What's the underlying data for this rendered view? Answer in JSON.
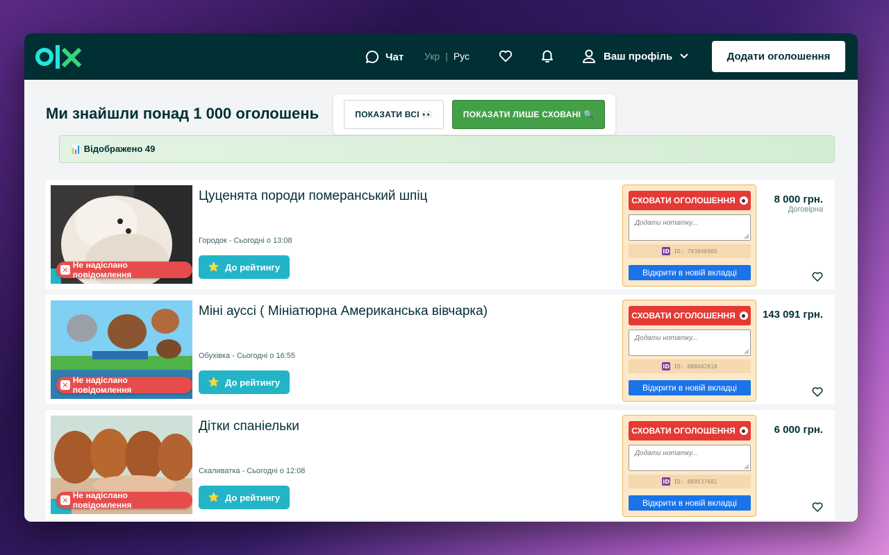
{
  "header": {
    "logo": "olx",
    "chat_label": "Чат",
    "lang_uk": "Укр",
    "lang_sep": "|",
    "lang_ru": "Рус",
    "profile_label": "Ваш профіль",
    "add_button_label": "Додати оголошення"
  },
  "main": {
    "found_title": "Ми знайшли понад 1 000 оголошень",
    "show_all_label": "ПОКАЗАТИ ВСІ 👀",
    "show_hidden_label": "ПОКАЗАТИ ЛИШЕ СХОВАНІ 🔍",
    "shown_label": "📊 Відображено 49"
  },
  "labels": {
    "no_message": "Не надіслано повідомлення",
    "rating": "До рейтингу",
    "hide": "СХОВАТИ ОГОЛОШЕННЯ",
    "note_placeholder": "Додати нотатку...",
    "open_new_tab": "Відкрити в новій вкладці"
  },
  "listings": [
    {
      "title": "Цуценята породи померанський шпіц",
      "location": "Городок - Сьогодні о 13:08",
      "price": "8 000 грн.",
      "negotiable": "Договірна",
      "id": "ID: 793846905"
    },
    {
      "title": "Міні ауссі ( Мініатюрна Американська вівчарка)",
      "location": "Обухівка - Сьогодні о 16:55",
      "price": "143 091 грн.",
      "negotiable": "",
      "id": "ID: 888042018"
    },
    {
      "title": "Дітки спаніельки",
      "location": "Скаливатка - Сьогодні о 12:08",
      "price": "6 000 грн.",
      "negotiable": "",
      "id": "ID: 889537681"
    }
  ],
  "colors": {
    "header_bg": "#002f34",
    "accent_teal": "#23b5c7",
    "hide_red": "#e53935",
    "open_blue": "#1a73e8",
    "green": "#43a047"
  }
}
